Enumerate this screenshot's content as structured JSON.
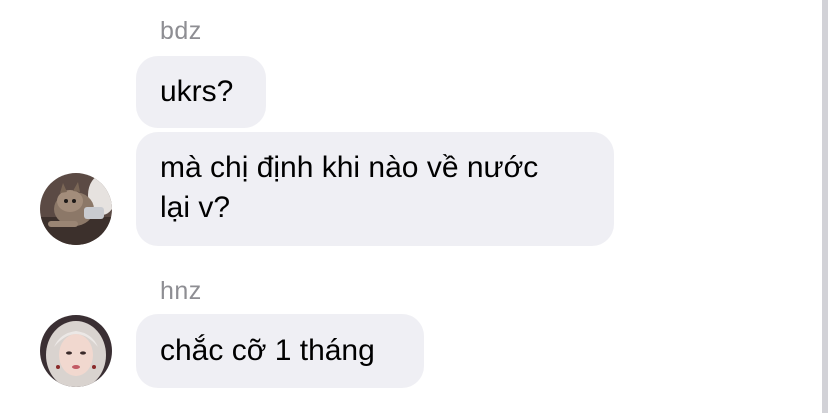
{
  "messages": [
    {
      "sender": "bdz",
      "bubbles": [
        {
          "text": "ukrs?"
        },
        {
          "text_lines": [
            "mà chị định khi nào về nước",
            "lại v?"
          ]
        }
      ],
      "avatar": "cat-photo-avatar"
    },
    {
      "sender": "hnz",
      "bubbles": [
        {
          "text": "chắc cỡ 1 tháng"
        }
      ],
      "avatar": "girl-photo-avatar"
    }
  ],
  "colors": {
    "bubble_bg": "#efeff4",
    "sender_name": "#8e8e93",
    "text": "#000000",
    "background": "#ffffff"
  }
}
